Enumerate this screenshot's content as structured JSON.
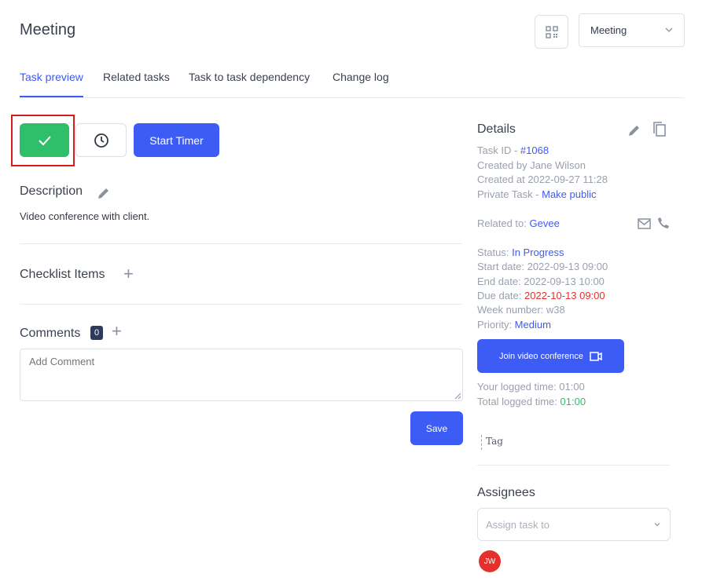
{
  "header": {
    "title": "Meeting",
    "type_select_value": "Meeting"
  },
  "tabs": [
    {
      "label": "Task preview",
      "active": true
    },
    {
      "label": "Related tasks",
      "active": false
    },
    {
      "label": "Task to task dependency",
      "active": false
    },
    {
      "label": "Change log",
      "active": false
    }
  ],
  "actions": {
    "start_timer_label": "Start Timer"
  },
  "description": {
    "heading": "Description",
    "text": "Video conference with client."
  },
  "checklist": {
    "heading": "Checklist Items"
  },
  "comments": {
    "heading": "Comments",
    "count": "0",
    "placeholder": "Add Comment",
    "save_label": "Save"
  },
  "details": {
    "heading": "Details",
    "task_id_label": "Task ID - ",
    "task_id_value": "#1068",
    "created_by": "Created by Jane Wilson",
    "created_at": "Created at 2022-09-27 11:28",
    "private_label": "Private Task - ",
    "private_link": "Make public",
    "related_label": "Related to: ",
    "related_value": "Gevee",
    "status_label": "Status: ",
    "status_value": "In Progress",
    "start_date": "Start date: 2022-09-13 09:00",
    "end_date": "End date: 2022-09-13 10:00",
    "due_label": "Due date: ",
    "due_value": "2022-10-13 09:00",
    "week_number": "Week number: w38",
    "priority_label": "Priority: ",
    "priority_value": "Medium",
    "join_label": "Join video conference",
    "your_logged": "Your logged time: 01:00",
    "total_logged_label": "Total logged time: ",
    "total_logged_value": "01:00",
    "tag_label": "Tag"
  },
  "assignees": {
    "heading": "Assignees",
    "placeholder": "Assign task to",
    "avatar_initials": "JW"
  },
  "colors": {
    "primary": "#3d5bf5",
    "success": "#2fbf6b",
    "danger": "#e5312d",
    "highlight": "#d21e1e"
  },
  "icons": [
    "qr-code-icon",
    "chevron-down-icon",
    "check-icon",
    "clock-icon",
    "pencil-icon",
    "plus-icon",
    "copy-icon",
    "mail-icon",
    "phone-icon",
    "video-icon",
    "resize-grip-icon"
  ]
}
